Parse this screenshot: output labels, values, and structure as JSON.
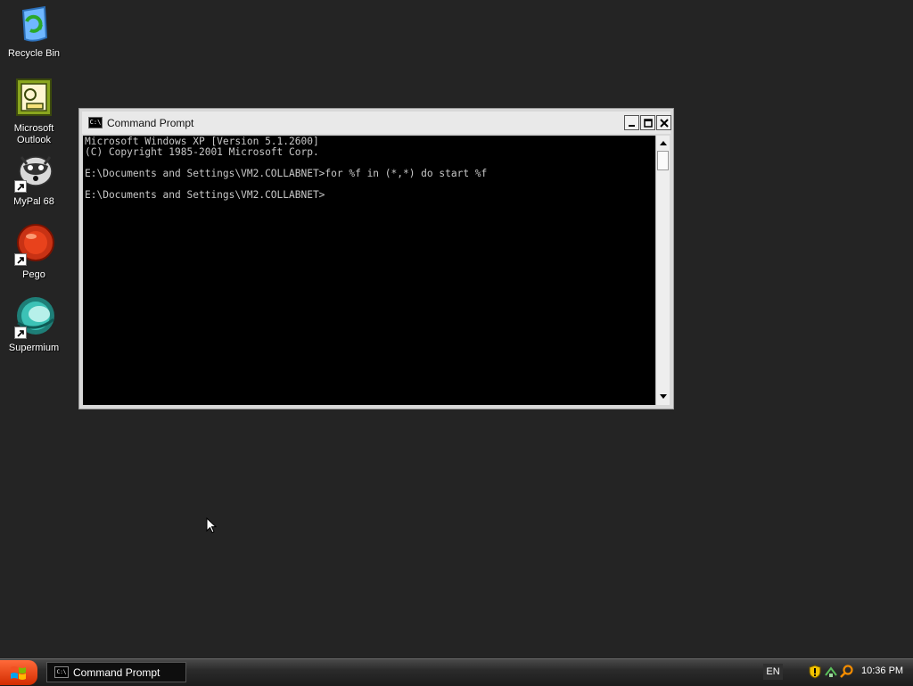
{
  "desktop": {
    "icons": [
      {
        "label": "Recycle Bin"
      },
      {
        "label": "Microsoft\nOutlook"
      },
      {
        "label": "MyPal 68"
      },
      {
        "label": "Pego"
      },
      {
        "label": "Supermium"
      }
    ]
  },
  "window": {
    "title": "Command Prompt",
    "icon_text": "C:\\",
    "console_lines": [
      "Microsoft Windows XP [Version 5.1.2600]",
      "(C) Copyright 1985-2001 Microsoft Corp.",
      "",
      "E:\\Documents and Settings\\VM2.COLLABNET>for %f in (*,*) do start %f",
      "",
      "E:\\Documents and Settings\\VM2.COLLABNET>"
    ]
  },
  "taskbar": {
    "task_label": "Command Prompt",
    "task_icon_text": "C:\\",
    "language": "EN",
    "clock": "10:36 PM"
  },
  "colors": {
    "desktop": "#242424",
    "console_bg": "#000000",
    "console_fg": "#c8c8c8",
    "start_button": "#e23c0a"
  }
}
